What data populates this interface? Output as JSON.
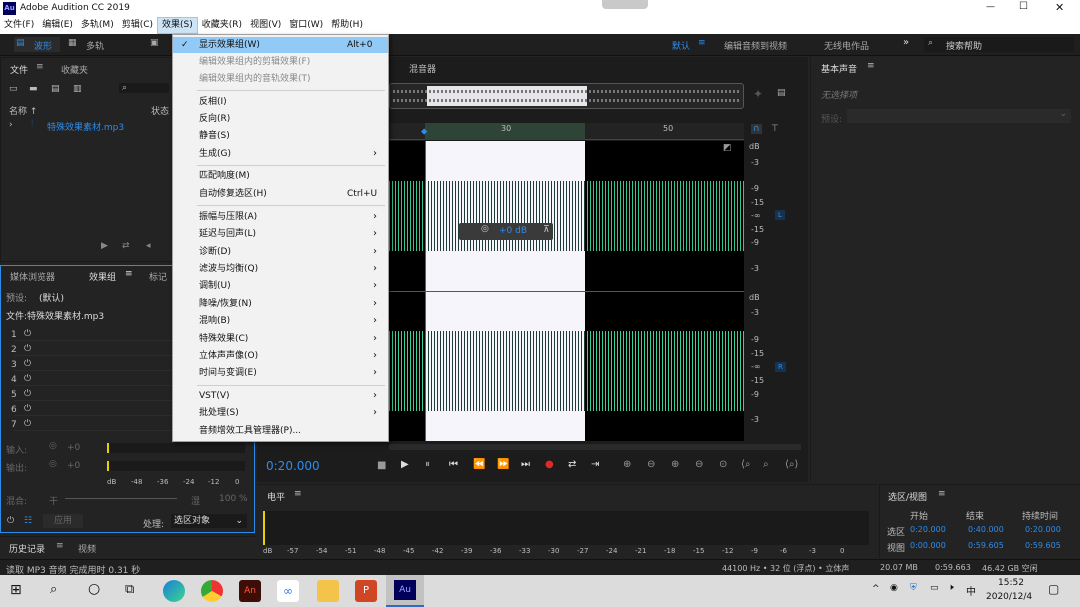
{
  "app": {
    "title": "Adobe Audition CC 2019",
    "logo": "Au"
  },
  "window_controls": {
    "minimize": "—",
    "maximize": "☐",
    "close": "✕"
  },
  "menu": [
    "文件(F)",
    "编辑(E)",
    "多轨(M)",
    "剪辑(C)",
    "效果(S)",
    "收藏夹(R)",
    "视图(V)",
    "窗口(W)",
    "帮助(H)"
  ],
  "toolbar": {
    "waveform": "波形",
    "multitrack": "多轨",
    "workspace": "默认",
    "ws_edit": "编辑音频到视频",
    "ws_wireless": "无线电作品",
    "search": "搜索帮助"
  },
  "files_panel": {
    "tab_files": "文件",
    "tab_fav": "收藏夹",
    "col_name": "名称 ↑",
    "col_status": "状态",
    "file": "特殊效果素材.mp3"
  },
  "effects_panel": {
    "tab_media": "媒体浏览器",
    "tab_rack": "效果组",
    "tab_marker": "标记",
    "preset_label": "预设:",
    "preset_value": "(默认)",
    "file_label": "文件:特殊效果素材.mp3",
    "slots": [
      "1",
      "2",
      "3",
      "4",
      "5",
      "6",
      "7"
    ],
    "input": "输入:",
    "output": "输出:",
    "db0": "+0",
    "mix": "混合:",
    "dry": "干",
    "wet": "湿",
    "pct": "100 %",
    "apply": "应用",
    "process": "处理:",
    "process_value": "选区对象",
    "scale": [
      "dB",
      "-48",
      "-36",
      "-24",
      "-12",
      "0"
    ]
  },
  "history_panel": {
    "tab_history": "历史记录",
    "tab_video": "视频"
  },
  "status": "读取 MP3 音频 完成用时 0.31 秒",
  "editor": {
    "tab_mixer": "混音器",
    "ruler": [
      "30",
      "50"
    ],
    "time": "0:20.000",
    "hud_db": "+0 dB",
    "db_labels_top": [
      "dB",
      "-3",
      "-9",
      "-15",
      "-∞",
      "-15",
      "-9",
      "-3"
    ],
    "db_labels_bot": [
      "dB",
      "-3",
      "-9",
      "-15",
      "-∞",
      "-15",
      "-9",
      "-3"
    ],
    "ch_l": "L",
    "ch_r": "R"
  },
  "dropdown": {
    "items": [
      {
        "label": "显示效果组(W)",
        "key": "Alt+0",
        "check": "✓",
        "state": "hi"
      },
      {
        "label": "编辑效果组内的剪辑效果(F)",
        "state": "dis"
      },
      {
        "label": "编辑效果组内的音轨效果(T)",
        "state": "dis"
      },
      {
        "label": "反相(I)"
      },
      {
        "label": "反向(R)"
      },
      {
        "label": "静音(S)"
      },
      {
        "label": "生成(G)",
        "arrow": "›"
      },
      {
        "label": "匹配响度(M)"
      },
      {
        "label": "自动修复选区(H)",
        "key": "Ctrl+U"
      },
      {
        "label": "振幅与压限(A)",
        "arrow": "›"
      },
      {
        "label": "延迟与回声(L)",
        "arrow": "›"
      },
      {
        "label": "诊断(D)",
        "arrow": "›"
      },
      {
        "label": "滤波与均衡(Q)",
        "arrow": "›"
      },
      {
        "label": "调制(U)",
        "arrow": "›"
      },
      {
        "label": "降噪/恢复(N)",
        "arrow": "›"
      },
      {
        "label": "混响(B)",
        "arrow": "›"
      },
      {
        "label": "特殊效果(C)",
        "arrow": "›"
      },
      {
        "label": "立体声声像(O)",
        "arrow": "›"
      },
      {
        "label": "时间与变调(E)",
        "arrow": "›"
      },
      {
        "label": "VST(V)",
        "arrow": "›"
      },
      {
        "label": "批处理(S)",
        "arrow": "›"
      },
      {
        "label": "音频增效工具管理器(P)..."
      }
    ]
  },
  "essential_sound": {
    "title": "基本声音",
    "no_selection": "无选择项",
    "preset": "预设:"
  },
  "levels": {
    "title": "电平",
    "scale": [
      "dB",
      "-57",
      "-54",
      "-51",
      "-48",
      "-45",
      "-42",
      "-39",
      "-36",
      "-33",
      "-30",
      "-27",
      "-24",
      "-21",
      "-18",
      "-15",
      "-12",
      "-9",
      "-6",
      "-3",
      "0"
    ]
  },
  "selection_view": {
    "title": "选区/视图",
    "col_start": "开始",
    "col_end": "结束",
    "col_dur": "持续时间",
    "row_sel": "选区",
    "row_view": "视图",
    "sel": [
      "0:20.000",
      "0:40.000",
      "0:20.000"
    ],
    "view": [
      "0:00.000",
      "0:59.605",
      "0:59.605"
    ]
  },
  "bottom_status": {
    "rate": "44100 Hz • 32 位 (浮点) • 立体声",
    "size": "20.07 MB",
    "dur": "0:59.663",
    "free": "46.42 GB 空闲"
  },
  "taskbar": {
    "ime": "中",
    "time": "15:52",
    "date": "2020/12/4"
  },
  "colors": {
    "waveform": "#35d19c",
    "selection": "#f5f5fb",
    "accent": "#2d8ceb",
    "playhead": "#e02a2a"
  }
}
